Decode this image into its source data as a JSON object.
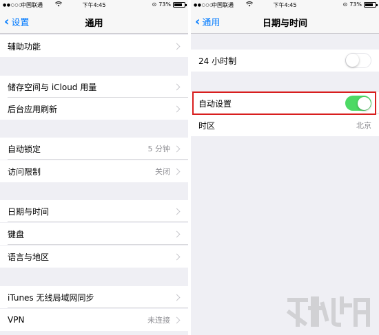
{
  "left": {
    "status": {
      "carrier": "中国联通",
      "time": "下午4:45",
      "battery": "73%"
    },
    "nav": {
      "back": "设置",
      "title": "通用"
    },
    "rows": [
      {
        "label": "辅助功能",
        "value": ""
      },
      {
        "label": "储存空间与 iCloud 用量",
        "value": ""
      },
      {
        "label": "后台应用刷新",
        "value": ""
      },
      {
        "label": "自动锁定",
        "value": "5 分钟"
      },
      {
        "label": "访问限制",
        "value": "关闭"
      },
      {
        "label": "日期与时间",
        "value": ""
      },
      {
        "label": "键盘",
        "value": ""
      },
      {
        "label": "语言与地区",
        "value": ""
      },
      {
        "label": "iTunes 无线局域网同步",
        "value": ""
      },
      {
        "label": "VPN",
        "value": "未连接"
      }
    ]
  },
  "right": {
    "status": {
      "carrier": "中国联通",
      "time": "下午4:45",
      "battery": "73%"
    },
    "nav": {
      "back": "通用",
      "title": "日期与时间"
    },
    "rows": [
      {
        "label": "24 小时制",
        "toggle": "off"
      },
      {
        "label": "自动设置",
        "toggle": "on"
      },
      {
        "label": "时区",
        "value": "北京"
      }
    ]
  },
  "colors": {
    "accent": "#007aff",
    "toggle_on": "#4cd964",
    "highlight": "#d81e1e",
    "group_bg": "#efeff4"
  },
  "icons": [
    "wifi-icon",
    "battery-icon",
    "chevron-left-icon",
    "chevron-right-icon",
    "watermark-logo"
  ]
}
